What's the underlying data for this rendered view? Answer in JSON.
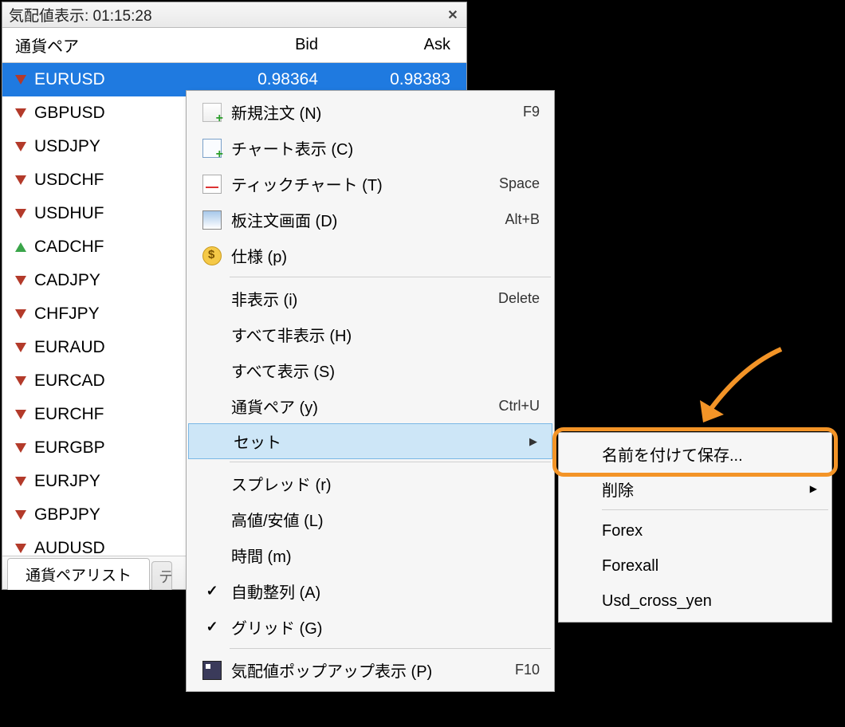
{
  "market_watch": {
    "title": "気配値表示: 01:15:28",
    "header": {
      "symbol": "通貨ペア",
      "bid": "Bid",
      "ask": "Ask"
    },
    "tab_active": "通貨ペアリスト",
    "tab_inactive": "テ",
    "rows": [
      {
        "symbol": "EURUSD",
        "dir": "down",
        "bid": "0.98364",
        "ask": "0.98383",
        "selected": true
      },
      {
        "symbol": "GBPUSD",
        "dir": "down"
      },
      {
        "symbol": "USDJPY",
        "dir": "down"
      },
      {
        "symbol": "USDCHF",
        "dir": "down"
      },
      {
        "symbol": "USDHUF",
        "dir": "down"
      },
      {
        "symbol": "CADCHF",
        "dir": "up"
      },
      {
        "symbol": "CADJPY",
        "dir": "down"
      },
      {
        "symbol": "CHFJPY",
        "dir": "down"
      },
      {
        "symbol": "EURAUD",
        "dir": "down"
      },
      {
        "symbol": "EURCAD",
        "dir": "down"
      },
      {
        "symbol": "EURCHF",
        "dir": "down"
      },
      {
        "symbol": "EURGBP",
        "dir": "down"
      },
      {
        "symbol": "EURJPY",
        "dir": "down"
      },
      {
        "symbol": "GBPJPY",
        "dir": "down"
      },
      {
        "symbol": "AUDUSD",
        "dir": "down"
      }
    ]
  },
  "context_menu": {
    "items": [
      {
        "icon": "order",
        "label": "新規注文 (N)",
        "shortcut": "F9"
      },
      {
        "icon": "chart",
        "label": "チャート表示 (C)",
        "shortcut": ""
      },
      {
        "icon": "tick",
        "label": "ティックチャート (T)",
        "shortcut": "Space"
      },
      {
        "icon": "dom",
        "label": "板注文画面 (D)",
        "shortcut": "Alt+B"
      },
      {
        "icon": "spec",
        "label": "仕様 (p)",
        "shortcut": ""
      },
      {
        "sep": true
      },
      {
        "icon": "",
        "label": "非表示 (i)",
        "shortcut": "Delete"
      },
      {
        "icon": "",
        "label": "すべて非表示 (H)",
        "shortcut": ""
      },
      {
        "icon": "",
        "label": "すべて表示 (S)",
        "shortcut": ""
      },
      {
        "icon": "",
        "label": "通貨ペア (y)",
        "shortcut": "Ctrl+U"
      },
      {
        "icon": "",
        "label": "セット",
        "shortcut": "",
        "submenu": true,
        "selected": true
      },
      {
        "sep": true
      },
      {
        "icon": "",
        "label": "スプレッド (r)",
        "shortcut": ""
      },
      {
        "icon": "",
        "label": "高値/安値 (L)",
        "shortcut": ""
      },
      {
        "icon": "",
        "label": "時間 (m)",
        "shortcut": ""
      },
      {
        "icon": "check",
        "label": "自動整列 (A)",
        "shortcut": ""
      },
      {
        "icon": "check",
        "label": "グリッド (G)",
        "shortcut": ""
      },
      {
        "sep": true
      },
      {
        "icon": "popup",
        "label": "気配値ポップアップ表示 (P)",
        "shortcut": "F10"
      }
    ]
  },
  "sub_menu": {
    "items": [
      {
        "label": "名前を付けて保存...",
        "highlight": true
      },
      {
        "label": "削除",
        "submenu": true
      },
      {
        "sep": true
      },
      {
        "label": "Forex"
      },
      {
        "label": "Forexall"
      },
      {
        "label": "Usd_cross_yen"
      }
    ]
  }
}
